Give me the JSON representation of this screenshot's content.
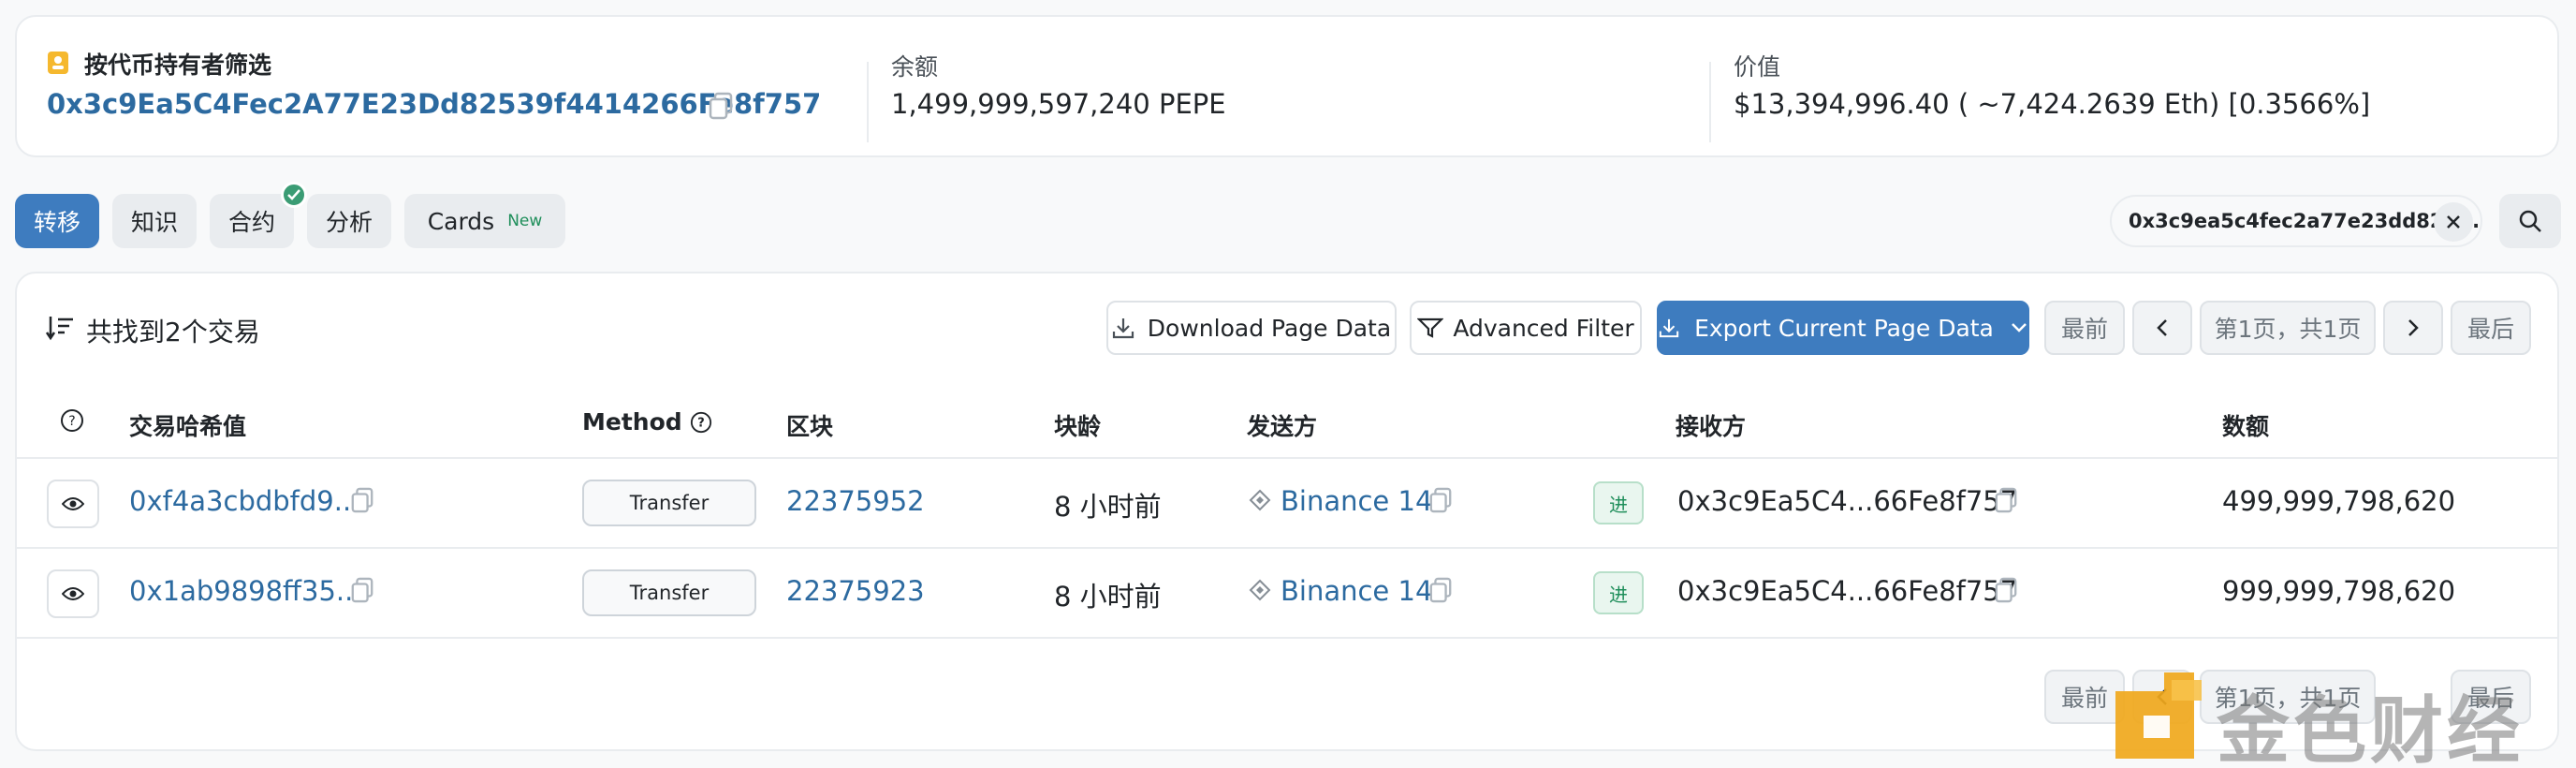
{
  "summary": {
    "filter_title": "按代币持有者筛选",
    "address": "0x3c9Ea5C4Fec2A77E23Dd82539f4414266Fe8f757",
    "balance_label": "余额",
    "balance_value": "1,499,999,597,240 PEPE",
    "value_label": "价值",
    "value_value": "$13,394,996.40 ( ~7,424.2639 Eth) [0.3566%]"
  },
  "tabs": [
    {
      "label": "转移",
      "active": true
    },
    {
      "label": "知识"
    },
    {
      "label": "合约"
    },
    {
      "label": "分析"
    },
    {
      "label": "Cards",
      "badge": "New"
    }
  ],
  "search": {
    "value": "0x3c9ea5c4fec2a77e23dd825..."
  },
  "toolbar": {
    "result_text": "共找到2个交易",
    "download_label": "Download Page Data",
    "filter_label": "Advanced Filter",
    "export_label": "Export Current Page Data"
  },
  "pagination": {
    "first": "最前",
    "page_info": "第1页，共1页",
    "last": "最后",
    "page_info_bottom": "第1页，共1页"
  },
  "table": {
    "columns": {
      "hash": "交易哈希值",
      "method": "Method",
      "block": "区块",
      "age": "块龄",
      "from": "发送方",
      "to": "接收方",
      "amount": "数额"
    },
    "rows": [
      {
        "hash": "0xf4a3cbdbfd9...",
        "method": "Transfer",
        "block": "22375952",
        "age": "8 小时前",
        "from": "Binance 14",
        "direction": "进",
        "to": "0x3c9Ea5C4...66Fe8f757",
        "amount": "499,999,798,620"
      },
      {
        "hash": "0x1ab9898ff35...",
        "method": "Transfer",
        "block": "22375923",
        "age": "8 小时前",
        "from": "Binance 14",
        "direction": "进",
        "to": "0x3c9Ea5C4...66Fe8f757",
        "amount": "999,999,798,620"
      }
    ]
  },
  "watermark": {
    "text": "金色财经"
  },
  "colors": {
    "accent": "#3e7cbf",
    "link": "#2c6aa0",
    "success": "#1e8e5a",
    "icon_yellow": "#f5b82e"
  }
}
